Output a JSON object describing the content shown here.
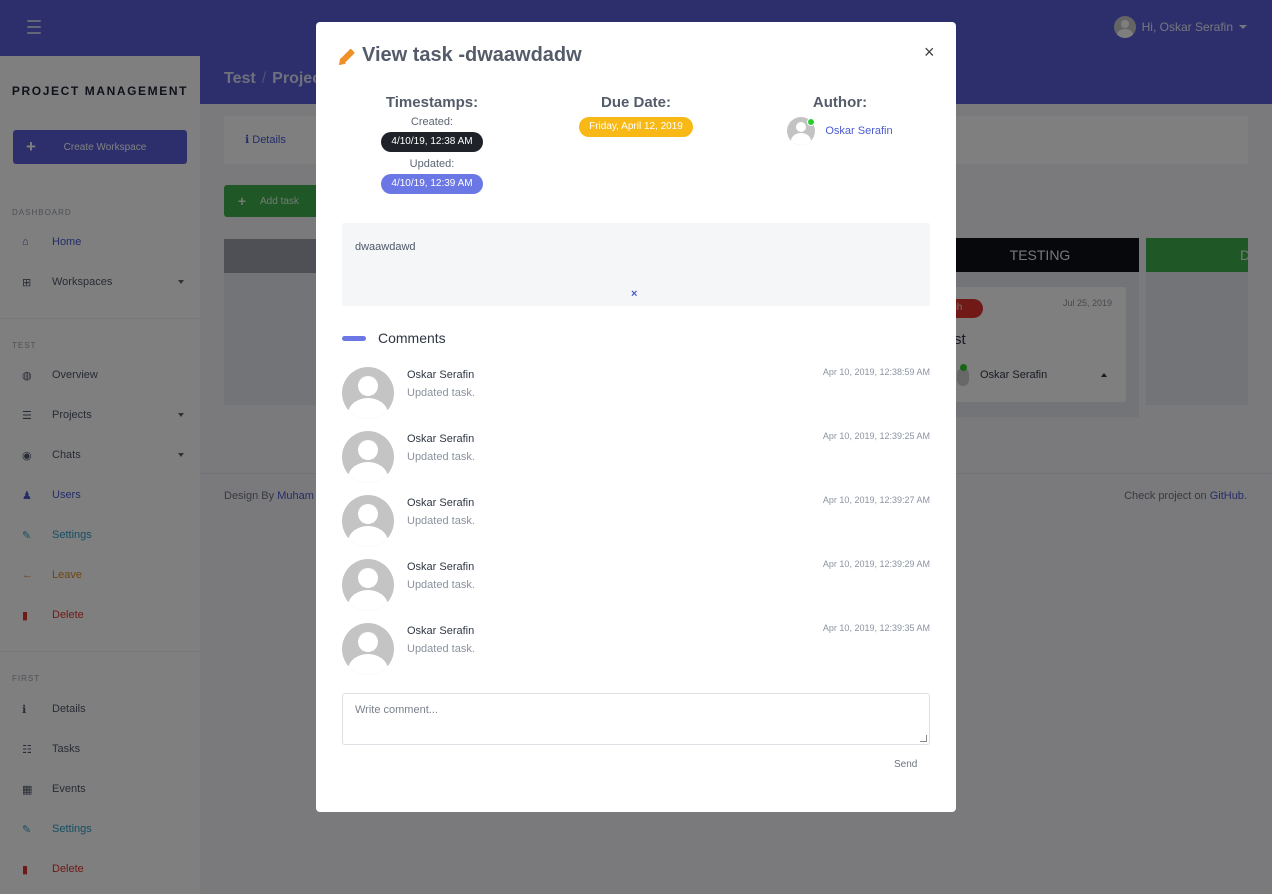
{
  "topbar": {
    "greeting": "Hi, Oskar Serafin"
  },
  "sidebar": {
    "brand": "PROJECT MANAGEMENT",
    "create_workspace": "Create Workspace",
    "sections": [
      {
        "label": "DASHBOARD",
        "items": [
          {
            "label": "Home",
            "icon": "home-icon",
            "glyph": "⌂",
            "color": "blue",
            "dropdown": false
          },
          {
            "label": "Workspaces",
            "icon": "sitemap-icon",
            "glyph": "⊞",
            "color": "gray",
            "dropdown": true
          }
        ]
      },
      {
        "label": "TEST",
        "items": [
          {
            "label": "Overview",
            "icon": "globe-icon",
            "glyph": "◍",
            "color": "gray",
            "dropdown": false
          },
          {
            "label": "Projects",
            "icon": "list-icon",
            "glyph": "☰",
            "color": "gray",
            "dropdown": true
          },
          {
            "label": "Chats",
            "icon": "comments-icon",
            "glyph": "◉",
            "color": "gray",
            "dropdown": true
          },
          {
            "label": "Users",
            "icon": "users-icon",
            "glyph": "♟",
            "color": "blue",
            "dropdown": false
          },
          {
            "label": "Settings",
            "icon": "edit-icon",
            "glyph": "✎",
            "color": "cyan",
            "dropdown": false
          },
          {
            "label": "Leave",
            "icon": "arrow-left-icon",
            "glyph": "←",
            "color": "orange",
            "dropdown": false
          },
          {
            "label": "Delete",
            "icon": "trash-icon",
            "glyph": "▮",
            "color": "red",
            "dropdown": false
          }
        ]
      },
      {
        "label": "FIRST",
        "items": [
          {
            "label": "Details",
            "icon": "info-icon",
            "glyph": "ℹ",
            "color": "gray",
            "dropdown": false
          },
          {
            "label": "Tasks",
            "icon": "tasks-icon",
            "glyph": "☷",
            "color": "gray",
            "dropdown": false
          },
          {
            "label": "Events",
            "icon": "calendar-icon",
            "glyph": "▦",
            "color": "gray",
            "dropdown": false
          },
          {
            "label": "Settings",
            "icon": "edit-icon",
            "glyph": "✎",
            "color": "cyan",
            "dropdown": false
          },
          {
            "label": "Delete",
            "icon": "trash-icon",
            "glyph": "▮",
            "color": "red",
            "dropdown": false
          }
        ]
      }
    ]
  },
  "background": {
    "breadcrumb": [
      "Test",
      "Projec"
    ],
    "tab_details": "Details",
    "add_task": "Add task",
    "column_testing": "TESTING",
    "column_green_partial": "D",
    "card_badge": "igh",
    "card_date": "Jul 25, 2019",
    "card_title": "st",
    "card_author": "Oskar Serafin",
    "footer_left_prefix": "Design By ",
    "footer_left_link": "Muham",
    "footer_right_prefix": "Check project on ",
    "footer_right_link": "GitHub",
    "footer_right_suffix": "."
  },
  "modal": {
    "title": "View task -dwaawdadw",
    "close": "×",
    "timestamps_label": "Timestamps:",
    "created_label": "Created:",
    "created_value": "4/10/19, 12:38 AM",
    "updated_label": "Updated:",
    "updated_value": "4/10/19, 12:39 AM",
    "due_label": "Due Date:",
    "due_value": "Friday, April 12, 2019",
    "author_label": "Author:",
    "author_name": "Oskar Serafin",
    "description": "dwaawdawd",
    "description_clear": "×",
    "comments_title": "Comments",
    "comments": [
      {
        "author": "Oskar Serafin",
        "text": "Updated task.",
        "time": "Apr 10, 2019, 12:38:59 AM"
      },
      {
        "author": "Oskar Serafin",
        "text": "Updated task.",
        "time": "Apr 10, 2019, 12:39:25 AM"
      },
      {
        "author": "Oskar Serafin",
        "text": "Updated task.",
        "time": "Apr 10, 2019, 12:39:27 AM"
      },
      {
        "author": "Oskar Serafin",
        "text": "Updated task.",
        "time": "Apr 10, 2019, 12:39:29 AM"
      },
      {
        "author": "Oskar Serafin",
        "text": "Updated task.",
        "time": "Apr 10, 2019, 12:39:35 AM"
      }
    ],
    "comment_placeholder": "Write comment...",
    "send": "Send"
  },
  "colors": {
    "primary": "#5a5fd9",
    "success": "#3fb04d",
    "danger": "#e1322d",
    "warning": "#f8b916",
    "accent": "#6b77e5"
  }
}
